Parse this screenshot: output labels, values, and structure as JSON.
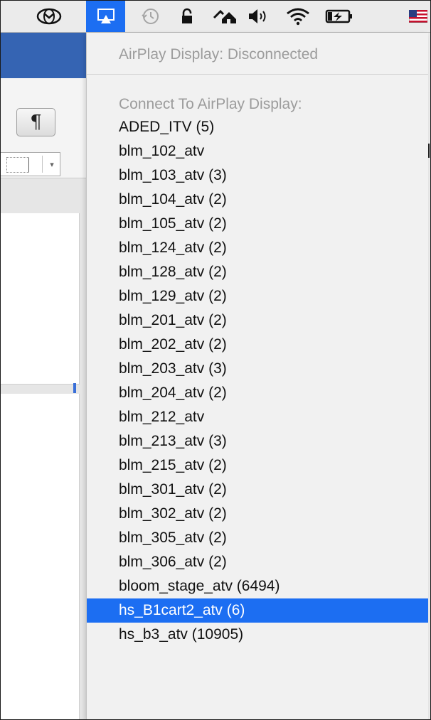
{
  "menubar": {
    "icons": [
      {
        "name": "fox-globe-icon"
      },
      {
        "name": "airplay-display-icon",
        "active": true
      },
      {
        "name": "time-machine-icon"
      },
      {
        "name": "lock-icon"
      },
      {
        "name": "network-shared-icon"
      },
      {
        "name": "volume-icon"
      },
      {
        "name": "wifi-icon"
      },
      {
        "name": "battery-charging-icon"
      },
      {
        "name": "us-flag-input-icon"
      }
    ],
    "accent_color": "#1c6ef2"
  },
  "background_app": {
    "title_color": "#3564b3",
    "pilcrow_label": "¶",
    "dropdown_arrow": "▾"
  },
  "airplay_menu": {
    "status": "AirPlay Display: Disconnected",
    "connect_header": "Connect To AirPlay Display:",
    "selected_index": 20,
    "items": [
      "ADED_ITV (5)",
      "blm_102_atv",
      "blm_103_atv (3)",
      "blm_104_atv (2)",
      "blm_105_atv (2)",
      "blm_124_atv (2)",
      "blm_128_atv (2)",
      "blm_129_atv (2)",
      "blm_201_atv (2)",
      "blm_202_atv (2)",
      "blm_203_atv (3)",
      "blm_204_atv (2)",
      "blm_212_atv",
      "blm_213_atv (3)",
      "blm_215_atv (2)",
      "blm_301_atv (2)",
      "blm_302_atv (2)",
      "blm_305_atv (2)",
      "blm_306_atv (2)",
      "bloom_stage_atv (6494)",
      "hs_B1cart2_atv (6)",
      "hs_b3_atv (10905)"
    ]
  }
}
